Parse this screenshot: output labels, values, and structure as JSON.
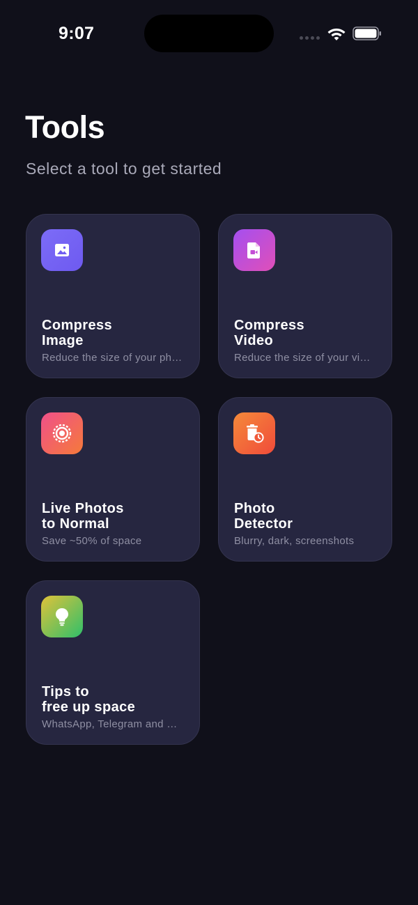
{
  "status_bar": {
    "time": "9:07"
  },
  "header": {
    "title": "Tools",
    "subtitle": "Select a tool to get started"
  },
  "tools": [
    {
      "title_line1": "Compress",
      "title_line2": "Image",
      "description": "Reduce the size of your photos",
      "icon": "image-icon",
      "gradient": [
        "#7c6cf7",
        "#6e5af0"
      ]
    },
    {
      "title_line1": "Compress",
      "title_line2": "Video",
      "description": "Reduce the size of your videos",
      "icon": "video-file-icon",
      "gradient": [
        "#a44ff0",
        "#e04fb8"
      ]
    },
    {
      "title_line1": "Live Photos",
      "title_line2": "to Normal",
      "description": "Save ~50% of space",
      "icon": "live-photo-icon",
      "gradient": [
        "#f0508a",
        "#f57a3a"
      ]
    },
    {
      "title_line1": "Photo",
      "title_line2": "Detector",
      "description": "Blurry, dark, screenshots",
      "icon": "trash-clock-icon",
      "gradient": [
        "#f58a3a",
        "#f04b3a"
      ]
    },
    {
      "title_line1": "Tips to",
      "title_line2": "free up space",
      "description": "WhatsApp, Telegram and more",
      "icon": "lightbulb-icon",
      "gradient": [
        "#e0c23a",
        "#2fbf6a"
      ]
    }
  ]
}
